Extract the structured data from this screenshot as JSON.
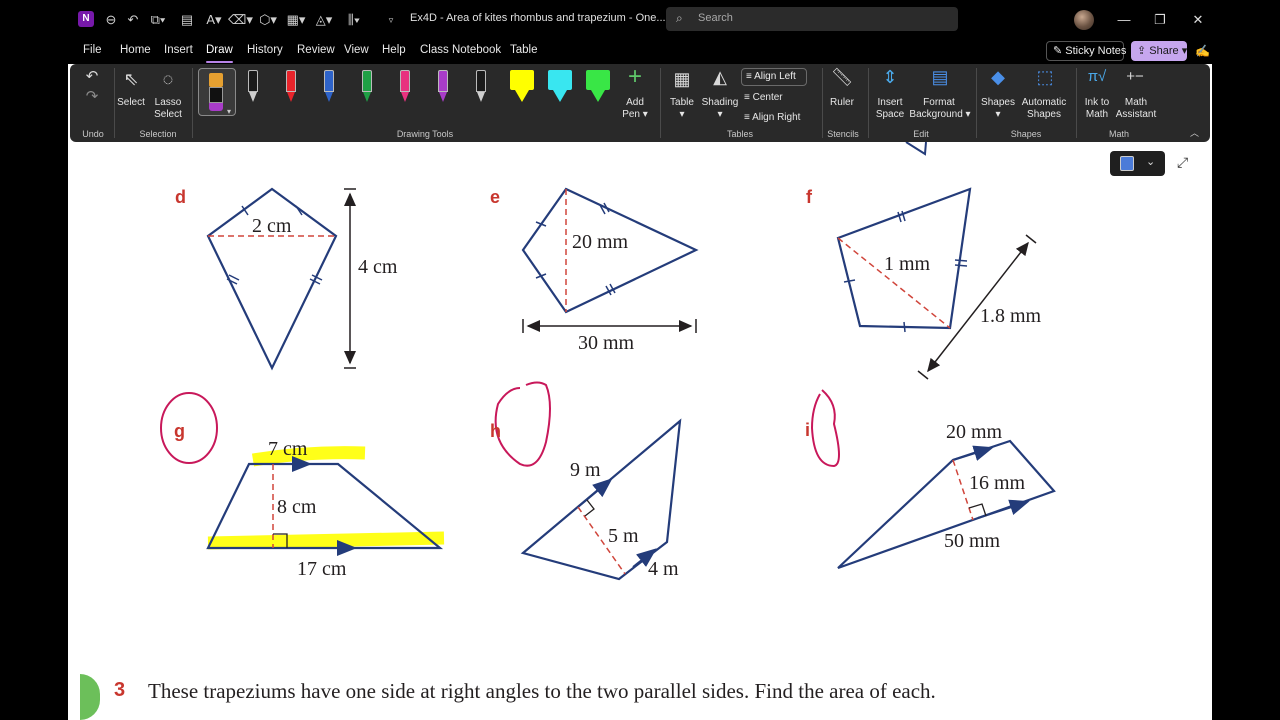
{
  "titlebar": {
    "doc_title": "Ex4D - Area of kites rhombus and trapezium  -  One...",
    "search_placeholder": "Search"
  },
  "menu": {
    "tabs": [
      "File",
      "Home",
      "Insert",
      "Draw",
      "History",
      "Review",
      "View",
      "Help",
      "Class Notebook",
      "Table"
    ],
    "active": "Draw",
    "sticky_notes": "Sticky Notes",
    "share": "Share"
  },
  "ribbon": {
    "undo_group": "Undo",
    "select": "Select",
    "lasso_1": "Lasso",
    "lasso_2": "Select",
    "selection_group": "Selection",
    "add_pen_1": "Add",
    "add_pen_2": "Pen",
    "drawing_tools_group": "Drawing Tools",
    "table": "Table",
    "shading": "Shading",
    "align_left": "Align Left",
    "center": "Center",
    "align_right": "Align Right",
    "tables_group": "Tables",
    "ruler": "Ruler",
    "stencils_group": "Stencils",
    "insert_space_1": "Insert",
    "insert_space_2": "Space",
    "format_bg_1": "Format",
    "format_bg_2": "Background",
    "edit_group": "Edit",
    "shapes": "Shapes",
    "auto_shapes_1": "Automatic",
    "auto_shapes_2": "Shapes",
    "shapes_group": "Shapes",
    "ink_math_1": "Ink to",
    "ink_math_2": "Math",
    "math_assist_1": "Math",
    "math_assist_2": "Assistant",
    "math_group": "Math",
    "pen_colors": [
      "#1a1a1a",
      "#e8242b",
      "#2e63c9",
      "#1fa045",
      "#e8327f",
      "#a83cc8",
      "#1a1a1a"
    ],
    "highlighter_colors": [
      "#ffff00",
      "#39e6f0",
      "#39e646"
    ],
    "active_pen_color": "#e6a030"
  },
  "figures": {
    "d": {
      "label": "d",
      "diag": "2 cm",
      "height": "4 cm"
    },
    "e": {
      "label": "e",
      "diag": "20 mm",
      "width": "30 mm"
    },
    "f": {
      "label": "f",
      "diag": "1 mm",
      "length": "1.8 mm"
    },
    "g": {
      "label": "g",
      "top": "7 cm",
      "height": "8 cm",
      "bottom": "17 cm"
    },
    "h": {
      "label": "h",
      "side": "9 m",
      "height": "5 m",
      "short": "4 m"
    },
    "i": {
      "label": "i",
      "top": "20 mm",
      "height": "16 mm",
      "bottom": "50 mm"
    }
  },
  "question3": {
    "number": "3",
    "text": "These trapeziums have one side at right angles to the two parallel sides. Find the area of each."
  }
}
